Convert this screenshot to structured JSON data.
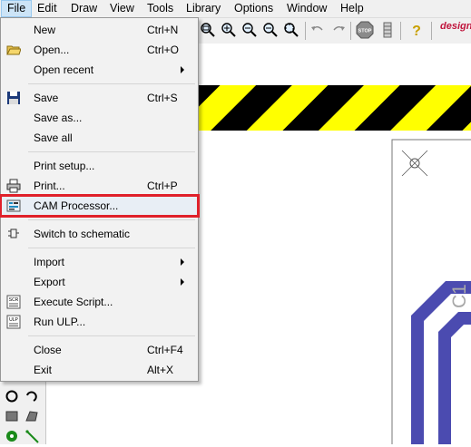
{
  "menubar": {
    "items": [
      {
        "label": "File"
      },
      {
        "label": "Edit"
      },
      {
        "label": "Draw"
      },
      {
        "label": "View"
      },
      {
        "label": "Tools"
      },
      {
        "label": "Library"
      },
      {
        "label": "Options"
      },
      {
        "label": "Window"
      },
      {
        "label": "Help"
      }
    ]
  },
  "toolbar": {
    "stop_label": "STOP",
    "brand_text": "design"
  },
  "file_menu": {
    "items": [
      {
        "label": "New",
        "shortcut": "Ctrl+N"
      },
      {
        "label": "Open...",
        "shortcut": "Ctrl+O"
      },
      {
        "label": "Open recent",
        "shortcut": ""
      },
      {
        "label": "Save",
        "shortcut": "Ctrl+S"
      },
      {
        "label": "Save as...",
        "shortcut": ""
      },
      {
        "label": "Save all",
        "shortcut": ""
      },
      {
        "label": "Print setup...",
        "shortcut": ""
      },
      {
        "label": "Print...",
        "shortcut": "Ctrl+P"
      },
      {
        "label": "CAM Processor...",
        "shortcut": ""
      },
      {
        "label": "Switch to schematic",
        "shortcut": ""
      },
      {
        "label": "Import",
        "shortcut": ""
      },
      {
        "label": "Export",
        "shortcut": ""
      },
      {
        "label": "Execute Script...",
        "shortcut": ""
      },
      {
        "label": "Run ULP...",
        "shortcut": ""
      },
      {
        "label": "Close",
        "shortcut": "Ctrl+F4"
      },
      {
        "label": "Exit",
        "shortcut": "Alt+X"
      }
    ]
  },
  "canvas": {
    "part_label": "C1"
  },
  "colors": {
    "hazard_yellow": "#ffff00",
    "hazard_black": "#000000",
    "trace_blue": "#4b4bb0",
    "highlight_red": "#e0202a"
  }
}
